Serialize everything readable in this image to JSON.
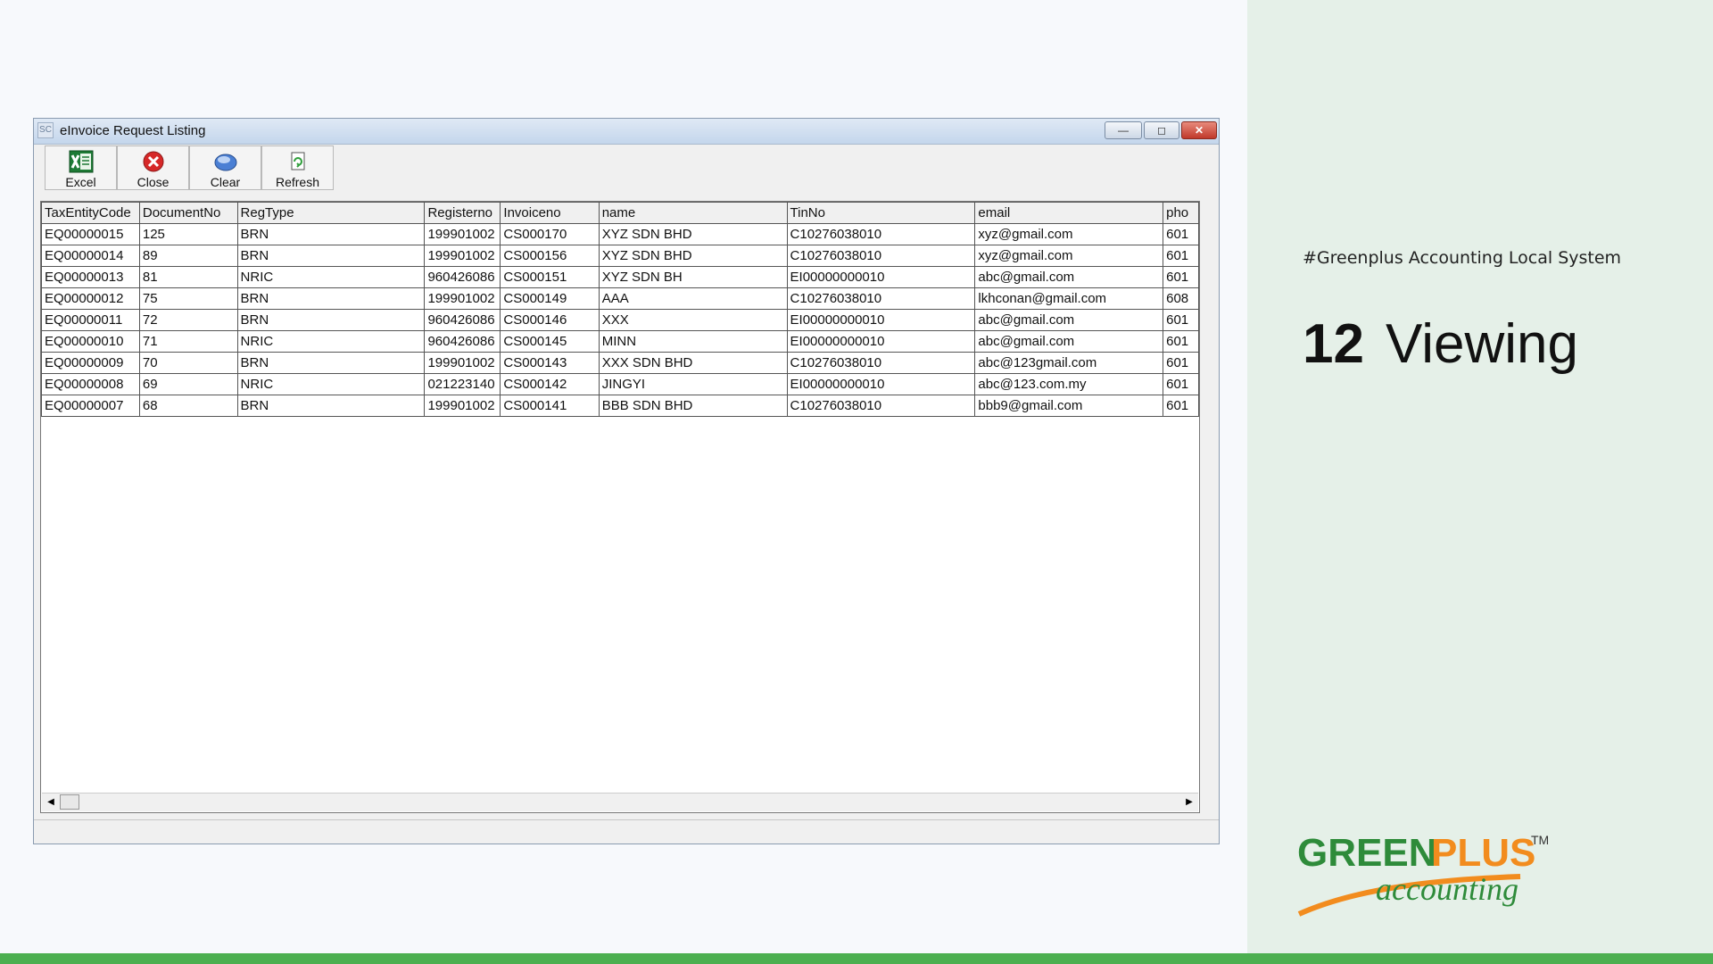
{
  "window": {
    "title": "eInvoice Request Listing",
    "icon_text": "SC",
    "buttons": {
      "minimize": "—",
      "maximize": "◻",
      "close": "✕"
    }
  },
  "toolbar": [
    {
      "label": "Excel",
      "icon": "excel-icon"
    },
    {
      "label": "Close",
      "icon": "close-icon"
    },
    {
      "label": "Clear",
      "icon": "clear-icon"
    },
    {
      "label": "Refresh",
      "icon": "refresh-icon"
    }
  ],
  "table": {
    "columns": [
      "TaxEntityCode",
      "DocumentNo",
      "RegType",
      "Registerno",
      "Invoiceno",
      "name",
      "TinNo",
      "email",
      "pho"
    ],
    "rows": [
      [
        "EQ00000015",
        "125",
        "BRN",
        "199901002",
        "CS000170",
        "XYZ SDN BHD",
        "C10276038010",
        "xyz@gmail.com",
        "601"
      ],
      [
        "EQ00000014",
        "89",
        "BRN",
        "199901002",
        "CS000156",
        "XYZ SDN BHD",
        "C10276038010",
        "xyz@gmail.com",
        "601"
      ],
      [
        "EQ00000013",
        "81",
        "NRIC",
        "960426086",
        "CS000151",
        "XYZ SDN BH",
        "EI00000000010",
        "abc@gmail.com",
        "601"
      ],
      [
        "EQ00000012",
        "75",
        "BRN",
        "199901002",
        "CS000149",
        "AAA",
        "C10276038010",
        "lkhconan@gmail.com",
        "608"
      ],
      [
        "EQ00000011",
        "72",
        "BRN",
        "960426086",
        "CS000146",
        "XXX",
        "EI00000000010",
        "abc@gmail.com",
        "601"
      ],
      [
        "EQ00000010",
        "71",
        "NRIC",
        "960426086",
        "CS000145",
        "MINN",
        "EI00000000010",
        "abc@gmail.com",
        "601"
      ],
      [
        "EQ00000009",
        "70",
        "BRN",
        "199901002",
        "CS000143",
        "XXX SDN BHD",
        "C10276038010",
        "abc@123gmail.com",
        "601"
      ],
      [
        "EQ00000008",
        "69",
        "NRIC",
        "021223140",
        "CS000142",
        "JINGYI",
        "EI00000000010",
        "abc@123.com.my",
        "601"
      ],
      [
        "EQ00000007",
        "68",
        "BRN",
        "199901002",
        "CS000141",
        "BBB SDN BHD",
        "C10276038010",
        "bbb9@gmail.com",
        "601"
      ]
    ]
  },
  "scrollbar": {
    "left_arrow": "◀",
    "right_arrow": "▶"
  },
  "slide": {
    "tagline": "#Greenplus Accounting Local System",
    "number": "12",
    "title": "Viewing"
  },
  "logo": {
    "line1a": "GREEN",
    "line1b": "PLUS",
    "tm": "TM",
    "line2": "accounting",
    "colors": {
      "green": "#2e8b3a",
      "orange": "#f28c1e"
    }
  }
}
